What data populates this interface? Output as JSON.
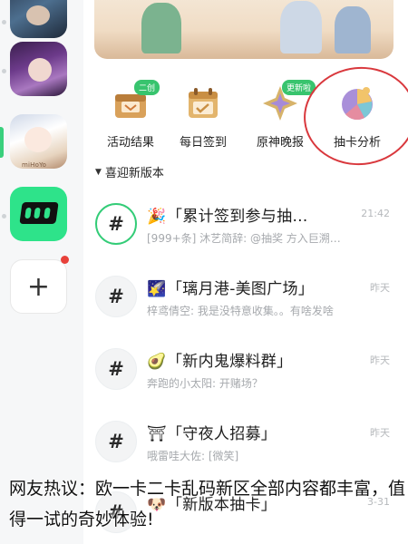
{
  "quick_actions": [
    {
      "label": "活动结果",
      "icon": "activity-chest-icon",
      "badge": "二创"
    },
    {
      "label": "每日签到",
      "icon": "calendar-check-icon",
      "badge": ""
    },
    {
      "label": "原神晚报",
      "icon": "star-medal-icon",
      "badge": "更新啦"
    },
    {
      "label": "抽卡分析",
      "icon": "pie-chart-icon",
      "badge": ""
    }
  ],
  "section": {
    "title": "喜迎新版本"
  },
  "channels": [
    {
      "emoji": "🎉",
      "name": "「累计签到参与抽…",
      "time": "21:42",
      "preview": "[999+条] 沐艺简辞: @抽奖 方入巨溯…"
    },
    {
      "emoji": "🌠",
      "name": "「璃月港-美图广场」",
      "time": "昨天",
      "preview": "梓鸢倩空: 我是没特意收集。。有啥发啥"
    },
    {
      "emoji": "🥑",
      "name": "「新内鬼爆料群」",
      "time": "昨天",
      "preview": "奔跑的小太阳: 开赌场？"
    },
    {
      "emoji": "⛩",
      "name": "「守夜人招募」",
      "time": "昨天",
      "preview": "哦雷哇大佐: [微笑]"
    },
    {
      "emoji": "🐶",
      "name": "「新版本抽卡」",
      "time": "3-31",
      "preview": ""
    }
  ],
  "rail": {
    "server3_caption": "miHoYo"
  },
  "overlay_caption": "网友热议：欧一卡二卡乱码新区全部内容都丰富，值得一试的奇妙体验!",
  "colors": {
    "accent_green": "#38c46e",
    "annotation_red": "#d9383d"
  }
}
